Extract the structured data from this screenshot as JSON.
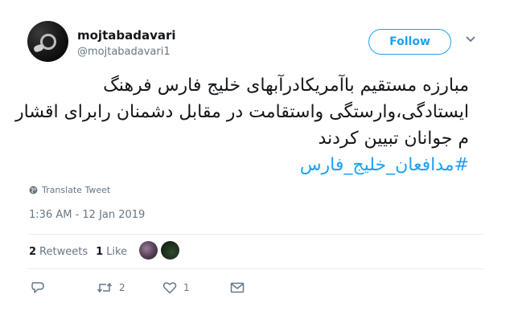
{
  "user": {
    "name": "mojtabadavari",
    "handle": "@mojtabadavari1"
  },
  "follow_label": "Follow",
  "tweet": {
    "line1": "مبارزه مستقیم باآمریکادرآبهای خلیج فارس فرهنگ",
    "line2": "ایستادگی،وارستگی واستقامت در مقابل دشمنان رابرای اقشار",
    "line3": "م جوانان تبیین کردند",
    "hashtag": "#مدافعان_خلیج_فارس"
  },
  "translate_label": "Translate Tweet",
  "timestamp": "1:36 AM - 12 Jan 2019",
  "stats": {
    "retweets_count": "2",
    "retweets_label": "Retweets",
    "likes_count": "1",
    "likes_label": "Like"
  },
  "actions": {
    "retweet_count": "2",
    "like_count": "1"
  },
  "colors": {
    "accent": "#1da1f2",
    "muted": "#657786"
  },
  "icons": [
    "globe-icon",
    "reply-icon",
    "retweet-icon",
    "heart-icon",
    "message-icon",
    "chevron-down-icon"
  ]
}
